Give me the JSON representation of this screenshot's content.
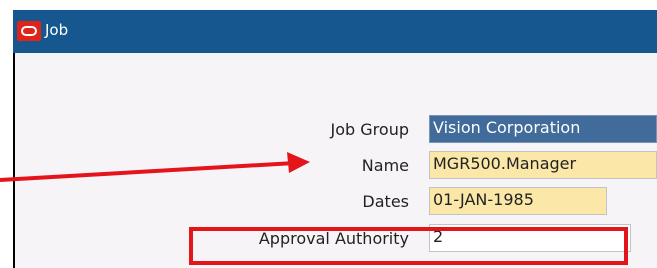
{
  "window": {
    "title": "Job"
  },
  "form": {
    "job_group": {
      "label": "Job Group",
      "value": "Vision Corporation"
    },
    "name": {
      "label": "Name",
      "value": "MGR500.Manager"
    },
    "dates": {
      "label": "Dates",
      "value": "01-JAN-1985"
    },
    "approval_authority": {
      "label": "Approval Authority",
      "value": "2"
    }
  },
  "annotations": {
    "color": "#e3151a"
  }
}
